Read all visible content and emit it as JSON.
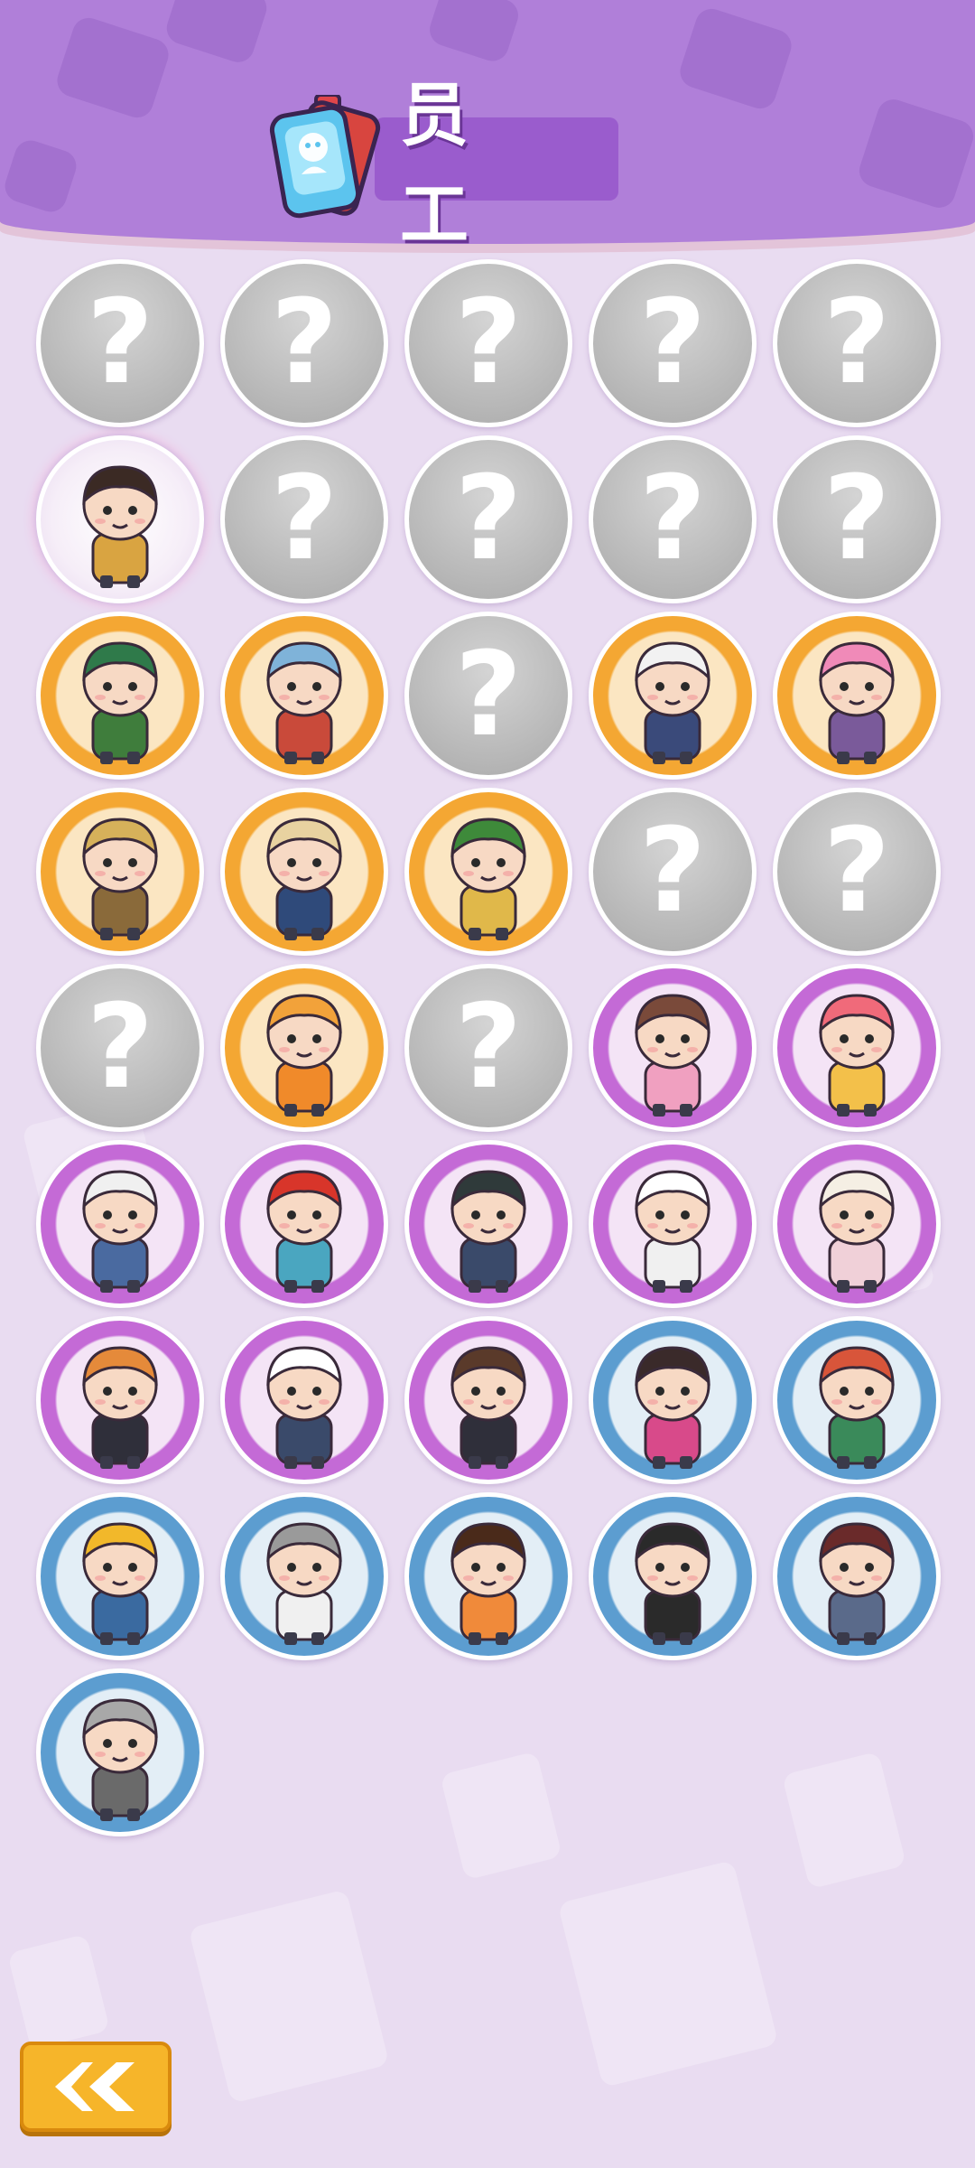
{
  "header": {
    "title": "员 工",
    "badge_icon": "employee-card-icon"
  },
  "locked_glyph": "?",
  "back_button": {
    "icon": "back-chevron-icon",
    "color": "#f6b52a"
  },
  "colors": {
    "header": "#b07fd9",
    "background": "#e9dcf1",
    "locked": "#b6b6b6",
    "rarity_orange": "#f4a733",
    "rarity_purple": "#c46ad6",
    "rarity_blue": "#5c9dd0"
  },
  "employees": [
    {
      "state": "locked"
    },
    {
      "state": "locked"
    },
    {
      "state": "locked"
    },
    {
      "state": "locked"
    },
    {
      "state": "locked"
    },
    {
      "state": "unlocked",
      "rarity": "special",
      "icon": "cat-ear-adventurer-girl-icon",
      "hair": "#3b2a24",
      "shirt": "#d9a441"
    },
    {
      "state": "locked"
    },
    {
      "state": "locked"
    },
    {
      "state": "locked"
    },
    {
      "state": "locked"
    },
    {
      "state": "unlocked",
      "rarity": "orange",
      "icon": "monkey-king-icon",
      "hair": "#2f7a4a",
      "shirt": "#3f7d3c"
    },
    {
      "state": "unlocked",
      "rarity": "orange",
      "icon": "astronaut-fish-icon",
      "hair": "#7fb3d9",
      "shirt": "#c94a3a"
    },
    {
      "state": "locked"
    },
    {
      "state": "unlocked",
      "rarity": "orange",
      "icon": "white-hair-cat-girl-icon",
      "hair": "#f2f2f2",
      "shirt": "#3a4a7a"
    },
    {
      "state": "unlocked",
      "rarity": "orange",
      "icon": "pink-hair-maid-icon",
      "hair": "#f08ab8",
      "shirt": "#7a5a9a"
    },
    {
      "state": "unlocked",
      "rarity": "orange",
      "icon": "seal-explorer-icon",
      "hair": "#d6b15a",
      "shirt": "#8a6a3a"
    },
    {
      "state": "unlocked",
      "rarity": "orange",
      "icon": "wolf-detective-icon",
      "hair": "#e8d2a0",
      "shirt": "#2f4a7a"
    },
    {
      "state": "unlocked",
      "rarity": "orange",
      "icon": "green-hair-bug-catcher-icon",
      "hair": "#3e8a3a",
      "shirt": "#e0b84a"
    },
    {
      "state": "locked"
    },
    {
      "state": "locked"
    },
    {
      "state": "locked"
    },
    {
      "state": "unlocked",
      "rarity": "orange",
      "icon": "robot-worker-icon",
      "hair": "#f2a23a",
      "shirt": "#f08a2a"
    },
    {
      "state": "locked"
    },
    {
      "state": "unlocked",
      "rarity": "purple",
      "icon": "glasses-schoolgirl-icon",
      "hair": "#7a4a3a",
      "shirt": "#f0a0c0"
    },
    {
      "state": "unlocked",
      "rarity": "purple",
      "icon": "pink-bun-girl-icon",
      "hair": "#f06a7a",
      "shirt": "#f3c04a"
    },
    {
      "state": "unlocked",
      "rarity": "purple",
      "icon": "chef-cat-fish-icon",
      "hair": "#f0f0f0",
      "shirt": "#4a6aa0"
    },
    {
      "state": "unlocked",
      "rarity": "purple",
      "icon": "bandana-boy-icon",
      "hair": "#d8352a",
      "shirt": "#4aa6c0"
    },
    {
      "state": "unlocked",
      "rarity": "purple",
      "icon": "cap-backpacker-icon",
      "hair": "#2f3a3a",
      "shirt": "#3a4a6a"
    },
    {
      "state": "unlocked",
      "rarity": "purple",
      "icon": "head-chef-icon",
      "hair": "#ffffff",
      "shirt": "#f0f0f0"
    },
    {
      "state": "unlocked",
      "rarity": "purple",
      "icon": "alpaca-gardener-icon",
      "hair": "#f5efe4",
      "shirt": "#f0d0d8"
    },
    {
      "state": "unlocked",
      "rarity": "purple",
      "icon": "corgi-icon",
      "hair": "#e58a3a",
      "shirt": "#2f2f3a"
    },
    {
      "state": "unlocked",
      "rarity": "purple",
      "icon": "panda-icon",
      "hair": "#ffffff",
      "shirt": "#3a4a6a"
    },
    {
      "state": "unlocked",
      "rarity": "purple",
      "icon": "otter-captain-icon",
      "hair": "#5a3a2a",
      "shirt": "#2f2f3a"
    },
    {
      "state": "unlocked",
      "rarity": "blue",
      "icon": "smiling-lady-icon",
      "hair": "#3a2a2a",
      "shirt": "#d84a8a"
    },
    {
      "state": "unlocked",
      "rarity": "blue",
      "icon": "red-hair-boy-icon",
      "hair": "#d8553a",
      "shirt": "#3a8a5a"
    },
    {
      "state": "unlocked",
      "rarity": "blue",
      "icon": "hard-hat-worker-icon",
      "hair": "#f2b82a",
      "shirt": "#3a6aa0"
    },
    {
      "state": "unlocked",
      "rarity": "blue",
      "icon": "old-man-icon",
      "hair": "#9a9a9a",
      "shirt": "#f0f0f0"
    },
    {
      "state": "unlocked",
      "rarity": "blue",
      "icon": "blushing-girl-icon",
      "hair": "#4a2a1a",
      "shirt": "#f08a3a"
    },
    {
      "state": "unlocked",
      "rarity": "blue",
      "icon": "beanie-man-icon",
      "hair": "#2a2a2a",
      "shirt": "#2a2a2a"
    },
    {
      "state": "unlocked",
      "rarity": "blue",
      "icon": "glasses-student-girl-icon",
      "hair": "#6a2a2a",
      "shirt": "#5a6a8a"
    },
    {
      "state": "unlocked",
      "rarity": "blue",
      "icon": "gray-hair-technician-icon",
      "hair": "#a8a8a8",
      "shirt": "#6a6a6a"
    }
  ]
}
